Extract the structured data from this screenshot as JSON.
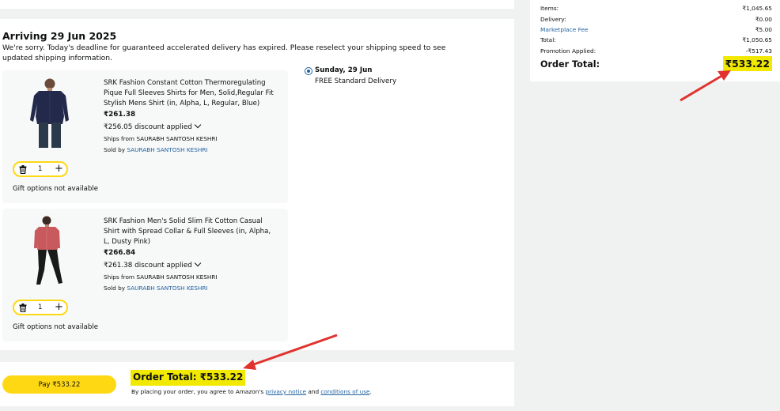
{
  "shipment": {
    "arriving": "Arriving 29 Jun 2025",
    "notice": "We're sorry. Today's deadline for guaranteed accelerated delivery has expired. Please reselect your shipping speed to see updated shipping information."
  },
  "items": [
    {
      "title": "SRK Fashion Constant Cotton Thermoregulating Pique Full Sleeves Shirts for Men, Solid,Regular Fit Stylish Mens Shirt (in, Alpha, L, Regular, Blue)",
      "price": "₹261.38",
      "discount": "₹256.05 discount applied",
      "ships_from": "Ships from SAURABH SANTOSH KESHRI",
      "sold_by_prefix": "Sold by ",
      "seller": "SAURABH SANTOSH KESHRI",
      "quantity": "1",
      "gift": "Gift options not available",
      "shirt_color": "#23294a"
    },
    {
      "title": "SRK Fashion Men's Solid Slim Fit Cotton Casual Shirt with Spread Collar & Full Sleeves (in, Alpha, L, Dusty Pink)",
      "price": "₹266.84",
      "discount": "₹261.38 discount applied",
      "ships_from": "Ships from SAURABH SANTOSH KESHRI",
      "sold_by_prefix": "Sold by ",
      "seller": "SAURABH SANTOSH KESHRI",
      "quantity": "1",
      "gift": "Gift options not available",
      "shirt_color": "#c85a5e"
    }
  ],
  "delivery_option": {
    "date": "Sunday, 29 Jun",
    "description": "FREE Standard Delivery"
  },
  "bottom": {
    "pay_label": "Pay ₹533.22",
    "order_total": "Order Total: ₹533.22",
    "legal_prefix": "By placing your order, you agree to Amazon's ",
    "privacy_link": "privacy notice",
    "legal_and": " and ",
    "conditions_link": "conditions of use",
    "legal_suffix": "."
  },
  "summary": {
    "rows": [
      {
        "label": "Items:",
        "value": "₹1,045.65"
      },
      {
        "label": "Delivery:",
        "value": "₹0.00"
      },
      {
        "label": "Marketplace Fee",
        "value": "₹5.00"
      },
      {
        "label": "Total:",
        "value": "₹1,050.65"
      },
      {
        "label": "Promotion Applied:",
        "value": "-₹517.43"
      }
    ],
    "order_total_label": "Order Total:",
    "order_total_value": "₹533.22"
  },
  "colors": {
    "highlight": "#f2e900",
    "button": "#ffd814",
    "link": "#2162a1",
    "arrow": "#e0332f"
  }
}
